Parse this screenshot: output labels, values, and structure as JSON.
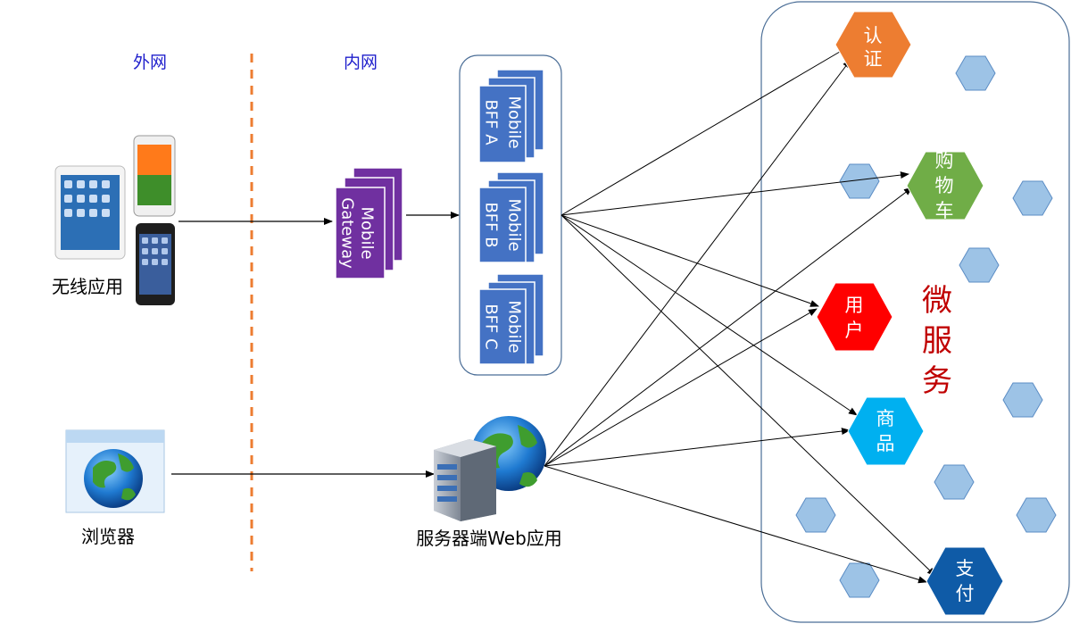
{
  "zones": {
    "external": "外网",
    "internal": "内网"
  },
  "clients": {
    "wireless": "无线应用",
    "browser": "浏览器"
  },
  "gateway": {
    "line1": "Mobile",
    "line2": "Gateway"
  },
  "bffs": [
    {
      "line1": "Mobile",
      "line2": "BFF A"
    },
    {
      "line1": "Mobile",
      "line2": "BFF B"
    },
    {
      "line1": "Mobile",
      "line2": "BFF C"
    }
  ],
  "web_app": {
    "label": "服务器端Web应用"
  },
  "microservices": {
    "title": [
      "微",
      "服",
      "务"
    ],
    "services": [
      {
        "chars": [
          "认",
          "证"
        ],
        "color": "#ED7D31"
      },
      {
        "chars": [
          "购",
          "物",
          "车"
        ],
        "color": "#70AD47"
      },
      {
        "chars": [
          "用",
          "户"
        ],
        "color": "#FF0000"
      },
      {
        "chars": [
          "商",
          "品"
        ],
        "color": "#00B0F0"
      },
      {
        "chars": [
          "支",
          "付"
        ],
        "color": "#0F5BA7"
      }
    ]
  },
  "colors": {
    "zone_label": "#1F1FCC",
    "divider": "#ED7D31",
    "gateway": "#7030A0",
    "bff": "#4472C4",
    "title_red": "#C00000",
    "small_hex": "#9DC3E6",
    "container_border": "#4A6D96"
  },
  "icons": {
    "wireless": "tablet-and-phones-icon",
    "browser": "browser-globe-icon",
    "web_app": "server-globe-icon"
  }
}
